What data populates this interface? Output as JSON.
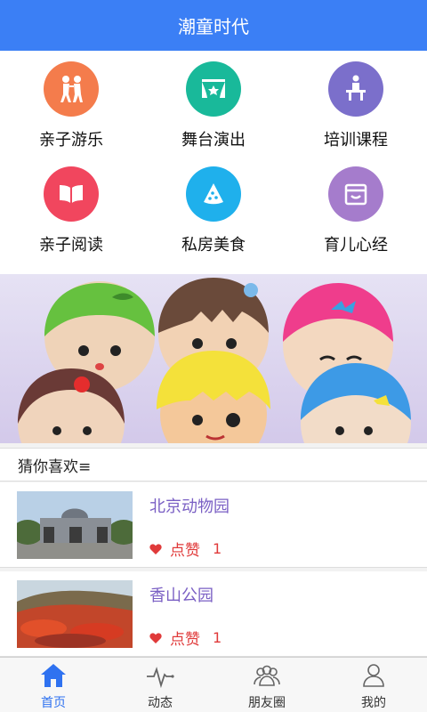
{
  "header": {
    "title": "潮童时代"
  },
  "categories": [
    {
      "label": "亲子游乐",
      "icon": "family-icon",
      "color": "#f47c4c"
    },
    {
      "label": "舞台演出",
      "icon": "stage-icon",
      "color": "#19b99a"
    },
    {
      "label": "培训课程",
      "icon": "teacher-icon",
      "color": "#7b6fcb"
    },
    {
      "label": "亲子阅读",
      "icon": "book-icon",
      "color": "#f1465e"
    },
    {
      "label": "私房美食",
      "icon": "pizza-icon",
      "color": "#1fb0ec"
    },
    {
      "label": "育儿心经",
      "icon": "box-icon",
      "color": "#a57ccc"
    }
  ],
  "section": {
    "title": "猜你喜欢≡"
  },
  "items": [
    {
      "title": "北京动物园",
      "like_label": "点赞",
      "likes": "1"
    },
    {
      "title": "香山公园",
      "like_label": "点赞",
      "likes": "1"
    }
  ],
  "tabs": [
    {
      "label": "首页",
      "icon": "home-icon",
      "active": true
    },
    {
      "label": "动态",
      "icon": "pulse-icon"
    },
    {
      "label": "朋友圈",
      "icon": "friends-icon"
    },
    {
      "label": "我的",
      "icon": "user-icon"
    }
  ],
  "colors": {
    "primary": "#3b7ff5",
    "accent": "#7a5fc4",
    "like": "#e03a3a"
  }
}
